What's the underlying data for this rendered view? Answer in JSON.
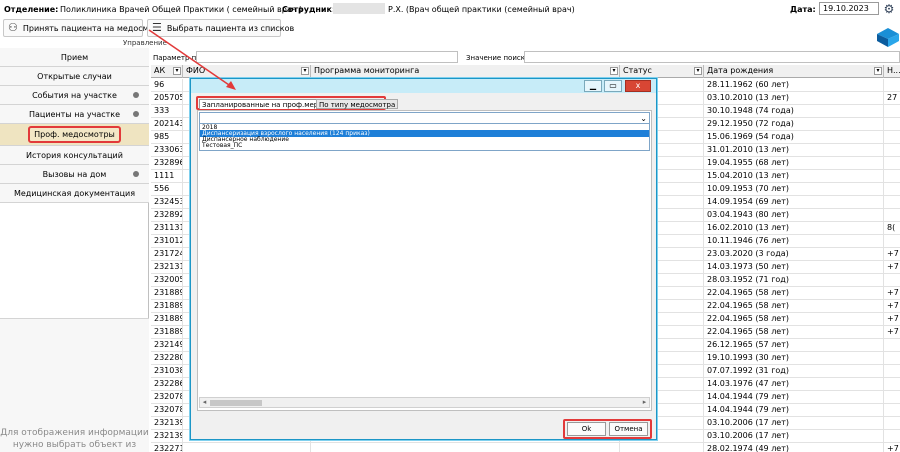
{
  "header": {
    "dept_label": "Отделение:",
    "dept_value": "Поликлиника Врачей Общей Практики ( семейный врач )",
    "emp_label": "Сотрудник:",
    "emp_value": "Р.Х. (Врач общей практики (семейный врач)",
    "date_label": "Дата:",
    "date_value": "19.10.2023"
  },
  "toolbar": {
    "accept_label": "Принять пациента на медосмотр",
    "select_label": "Выбрать пациента из списков",
    "group_label": "Управление"
  },
  "sidebar": {
    "items": [
      {
        "label": "Прием"
      },
      {
        "label": "Открытые случаи"
      },
      {
        "label": "События на участке"
      },
      {
        "label": "Пациенты на участке"
      },
      {
        "label": "Проф. медосмотры"
      },
      {
        "label": "История консультаций"
      },
      {
        "label": "Вызовы на дом"
      },
      {
        "label": "Медицинская документация"
      }
    ],
    "empty_text": "Для отображения информации нужно выбрать объект из списка"
  },
  "search": {
    "param_label": "Параметр поиска",
    "value_label": "Значение поиска"
  },
  "grid": {
    "columns": [
      "АК",
      "ФИО",
      "Программа мониторинга",
      "Статус",
      "Дата рождения",
      "Н..."
    ],
    "rows": [
      {
        "ak": "96",
        "dob": "28.11.1962 (60 лет)",
        "extra": ""
      },
      {
        "ak": "205705",
        "dob": "03.10.2010 (13 лет)",
        "extra": "27"
      },
      {
        "ak": "333",
        "dob": "30.10.1948 (74 года)",
        "extra": ""
      },
      {
        "ak": "202143",
        "dob": "29.12.1950 (72 года)",
        "extra": ""
      },
      {
        "ak": "985",
        "dob": "15.06.1969 (54 года)",
        "extra": ""
      },
      {
        "ak": "233063",
        "dob": "31.01.2010 (13 лет)",
        "extra": ""
      },
      {
        "ak": "232896",
        "dob": "19.04.1955 (68 лет)",
        "extra": ""
      },
      {
        "ak": "1111",
        "dob": "15.04.2010 (13 лет)",
        "extra": ""
      },
      {
        "ak": "556",
        "dob": "10.09.1953 (70 лет)",
        "extra": ""
      },
      {
        "ak": "232453",
        "dob": "14.09.1954 (69 лет)",
        "extra": ""
      },
      {
        "ak": "232892",
        "dob": "03.04.1943 (80 лет)",
        "extra": ""
      },
      {
        "ak": "231131",
        "dob": "16.02.2010 (13 лет)",
        "extra": "8("
      },
      {
        "ak": "231012",
        "dob": "10.11.1946 (76 лет)",
        "extra": ""
      },
      {
        "ak": "231724",
        "dob": "23.03.2020 (3 года)",
        "extra": "+7"
      },
      {
        "ak": "232131",
        "dob": "14.03.1973 (50 лет)",
        "extra": "+7"
      },
      {
        "ak": "232005",
        "dob": "28.03.1952 (71 год)",
        "extra": ""
      },
      {
        "ak": "231889",
        "dob": "22.04.1965 (58 лет)",
        "extra": "+7"
      },
      {
        "ak": "231889",
        "dob": "22.04.1965 (58 лет)",
        "extra": "+7"
      },
      {
        "ak": "231889",
        "dob": "22.04.1965 (58 лет)",
        "extra": "+7"
      },
      {
        "ak": "231889",
        "dob": "22.04.1965 (58 лет)",
        "extra": "+7"
      },
      {
        "ak": "232149",
        "dob": "26.12.1965 (57 лет)",
        "extra": ""
      },
      {
        "ak": "232280",
        "dob": "19.10.1993 (30 лет)",
        "extra": ""
      },
      {
        "ak": "231038",
        "dob": "07.07.1992 (31 год)",
        "extra": ""
      },
      {
        "ak": "232286",
        "dob": "14.03.1976 (47 лет)",
        "extra": ""
      },
      {
        "ak": "232078",
        "dob": "14.04.1944 (79 лет)",
        "extra": ""
      },
      {
        "ak": "232078",
        "dob": "14.04.1944 (79 лет)",
        "extra": ""
      },
      {
        "ak": "232139",
        "dob": "03.10.2006 (17 лет)",
        "extra": ""
      },
      {
        "ak": "232139",
        "dob": "03.10.2006 (17 лет)",
        "extra": ""
      },
      {
        "ak": "232271",
        "dob": "28.02.1974 (49 лет)",
        "extra": "+7"
      }
    ]
  },
  "modal": {
    "close_glyph": "x",
    "tab_planned": "Запланированные на проф.мероприятия",
    "tab_type": "По типу медосмотра",
    "list_items": [
      "2018",
      "Диспансеризация взрослого населения (124 приказ)",
      "Диспансерное наблюдение",
      "Тестовая_ПС"
    ],
    "ok_label": "Ok",
    "cancel_label": "Отмена"
  },
  "colors": {
    "annotation_red": "#e23a3a",
    "dialog_border": "#1c96c6",
    "selection_blue": "#1e7fd8",
    "active_tab_bg": "#efe4c1"
  }
}
